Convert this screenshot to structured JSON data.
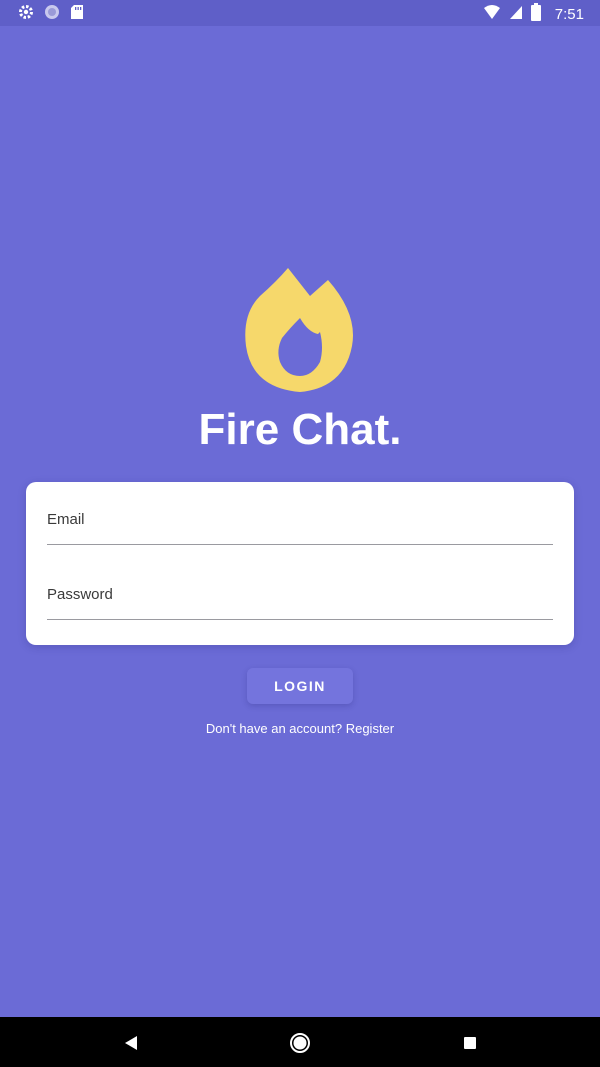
{
  "status_bar": {
    "time": "7:51",
    "left_icons": [
      "gear-icon",
      "sync-icon",
      "sd-card-icon"
    ],
    "right_icons": [
      "wifi-icon",
      "signal-icon",
      "battery-icon"
    ]
  },
  "app": {
    "title": "Fire Chat.",
    "logo_icon": "flame-logo-icon"
  },
  "form": {
    "email_placeholder": "Email",
    "password_placeholder": "Password",
    "login_label": "LOGIN",
    "register_prompt": "Don't have an account?",
    "register_link": "Register"
  },
  "nav_bar": {
    "buttons": [
      "back-icon",
      "home-icon",
      "recents-icon"
    ]
  },
  "colors": {
    "background": "#6b6bd6",
    "status_bar": "#5f5fc8",
    "logo": "#f6d86b",
    "card": "#ffffff",
    "button": "#7474dd"
  }
}
